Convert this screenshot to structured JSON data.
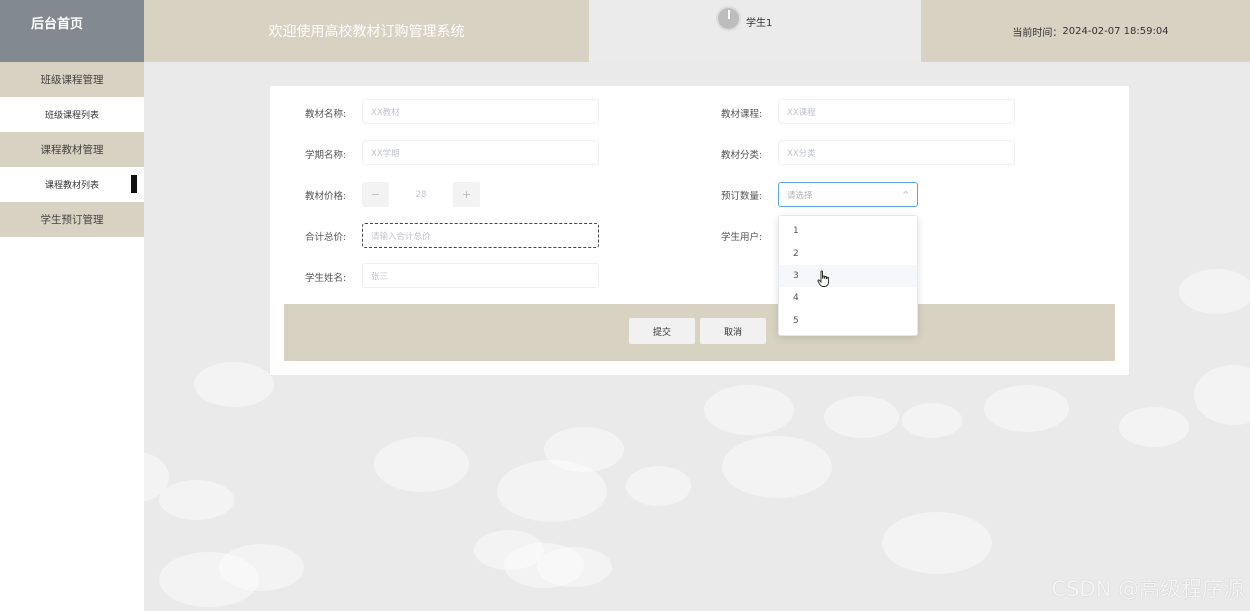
{
  "header": {
    "brand": "后台首页",
    "title": "欢迎使用高校教材订购管理系统",
    "username": "学生1",
    "time_label": "当前时间：",
    "time_value": "2024-02-07 18:59:04"
  },
  "sidebar": {
    "groups": [
      {
        "label": "班级课程管理",
        "items": [
          "班级课程列表"
        ]
      },
      {
        "label": "课程教材管理",
        "items": [
          "课程教材列表"
        ]
      },
      {
        "label": "学生预订管理",
        "items": []
      }
    ]
  },
  "form": {
    "textbook_name": {
      "label": "教材名称:",
      "placeholder": "XX教材"
    },
    "textbook_course": {
      "label": "教材课程:",
      "placeholder": "XX课程"
    },
    "term_name": {
      "label": "学期名称:",
      "placeholder": "XX学期"
    },
    "textbook_category": {
      "label": "教材分类:",
      "placeholder": "XX分类"
    },
    "price": {
      "label": "教材价格:",
      "value": "28",
      "minus": "−",
      "plus": "+"
    },
    "order_qty": {
      "label": "预订数量:",
      "placeholder": "请选择",
      "chevron": "^"
    },
    "total": {
      "label": "合计总价:",
      "placeholder": "请输入合计总价"
    },
    "student_user": {
      "label": "学生用户:"
    },
    "student_name": {
      "label": "学生姓名:",
      "placeholder": "张三"
    }
  },
  "actions": {
    "submit": "提交",
    "cancel": "取消"
  },
  "dropdown": {
    "options": [
      "1",
      "2",
      "3",
      "4",
      "5"
    ],
    "hovered": "3"
  },
  "watermark": "CSDN @高级程序源"
}
